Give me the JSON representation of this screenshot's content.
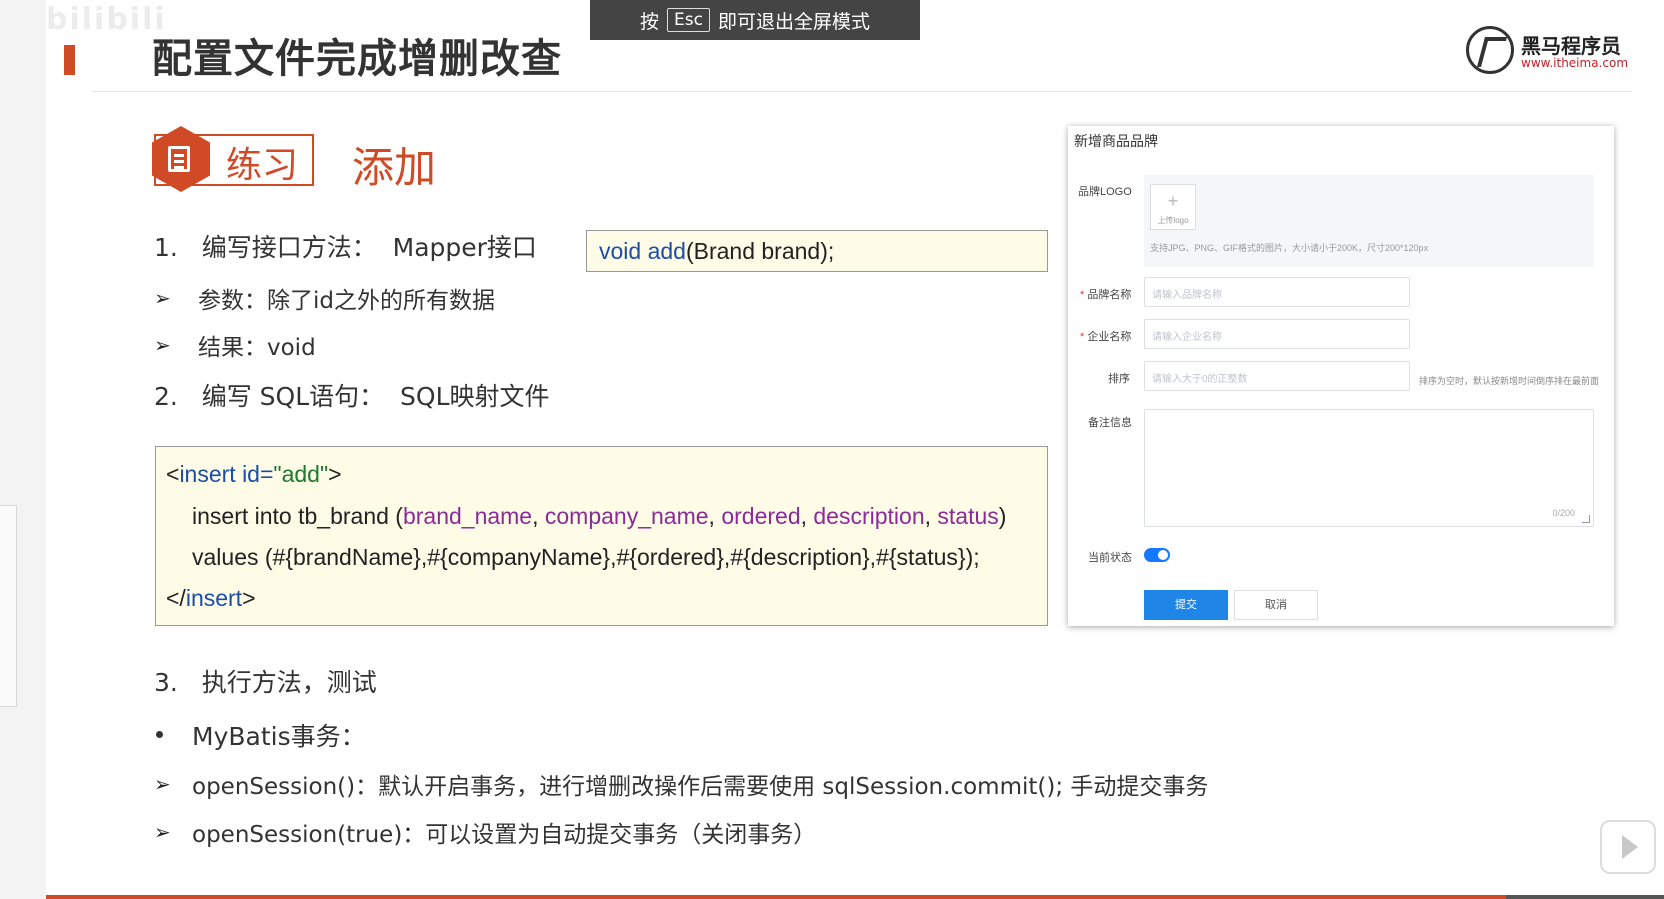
{
  "esc_hint": {
    "prefix": "按",
    "key": "Esc",
    "suffix": "即可退出全屏模式"
  },
  "header": {
    "title": "配置文件完成增删改查"
  },
  "logo": {
    "name": "黑马程序员",
    "url": "www.itheima.com"
  },
  "watermark": "bilibili",
  "practice": {
    "label": "练习",
    "topic": "添加"
  },
  "steps": [
    {
      "num": "1.",
      "text": "编写接口方法：",
      "sub": "Mapper接口"
    },
    {
      "num": "2.",
      "text": "编写 SQL语句：",
      "sub": "SQL映射文件"
    },
    {
      "num": "3.",
      "text": "执行方法，测试"
    }
  ],
  "points": {
    "params": "参数：除了id之外的所有数据",
    "result": "结果：void",
    "mybatis": "MyBatis事务：",
    "open_session": "openSession()：默认开启事务，进行增删改操作后需要使用 sqlSession.commit(); 手动提交事务",
    "open_session_true": "openSession(true)：可以设置为自动提交事务（关闭事务）"
  },
  "method_code": {
    "kw1": "void",
    "kw2": "add",
    "rest": "(Brand brand);"
  },
  "sql": {
    "open_lt": "<",
    "open_tag": "insert id=",
    "open_val": "\"add\"",
    "open_gt": ">",
    "l2_a": "insert into tb_brand (",
    "cols": [
      "brand_name",
      "company_name",
      "ordered",
      "description",
      "status"
    ],
    "l2_close": ")",
    "l3": "values (#{brandName},#{companyName},#{ordered},#{description},#{status});",
    "close_lt": "</",
    "close_tag": "insert",
    "close_gt": ">"
  },
  "form": {
    "title": "新增商品品牌",
    "logo_label": "品牌LOGO",
    "upload_label": "上传logo",
    "upload_tip": "支持JPG、PNG、GIF格式的图片，大小请小于200K，尺寸200*120px",
    "brand_label": "品牌名称",
    "brand_placeholder": "请输入品牌名称",
    "company_label": "企业名称",
    "company_placeholder": "请输入企业名称",
    "order_label": "排序",
    "order_placeholder": "请输入大于0的正整数",
    "order_tip": "排序为空时，默认按新增时间倒序排在最前面",
    "desc_label": "备注信息",
    "desc_count": "0/200",
    "status_label": "当前状态",
    "status_on": true,
    "submit": "提交",
    "cancel": "取消",
    "required_mark": "*"
  },
  "colors": {
    "accent": "#d04a26",
    "primary": "#1f86e8",
    "code_bg": "#fefbe6"
  }
}
